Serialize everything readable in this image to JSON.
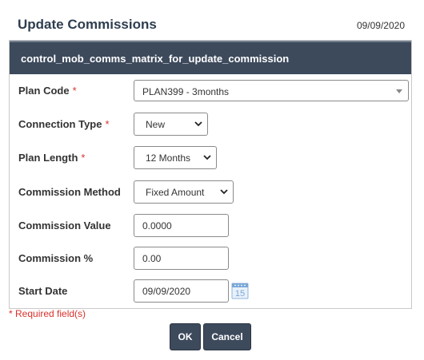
{
  "dialog": {
    "title": "Update Commissions",
    "date": "09/09/2020",
    "panel_title": "control_mob_comms_matrix_for_update_commission"
  },
  "form": {
    "plan_code": {
      "label": "Plan Code",
      "required_mark": "*",
      "value": "PLAN399 - 3months"
    },
    "connection_type": {
      "label": "Connection Type",
      "required_mark": "*",
      "value": "New"
    },
    "plan_length": {
      "label": "Plan Length",
      "required_mark": "*",
      "value": "12 Months"
    },
    "commission_method": {
      "label": "Commission Method",
      "value": "Fixed Amount"
    },
    "commission_value": {
      "label": "Commission Value",
      "value": "0.0000"
    },
    "commission_pct": {
      "label": "Commission %",
      "value": "0.00"
    },
    "start_date": {
      "label": "Start Date",
      "value": "09/09/2020",
      "calendar_icon": "calendar-icon",
      "calendar_day": "15"
    }
  },
  "footer": {
    "required_note": "* Required field(s)",
    "ok_label": "OK",
    "cancel_label": "Cancel"
  },
  "colors": {
    "header_bg": "#3d4a5c",
    "required": "#d9312b",
    "title": "#2e3d4f"
  }
}
